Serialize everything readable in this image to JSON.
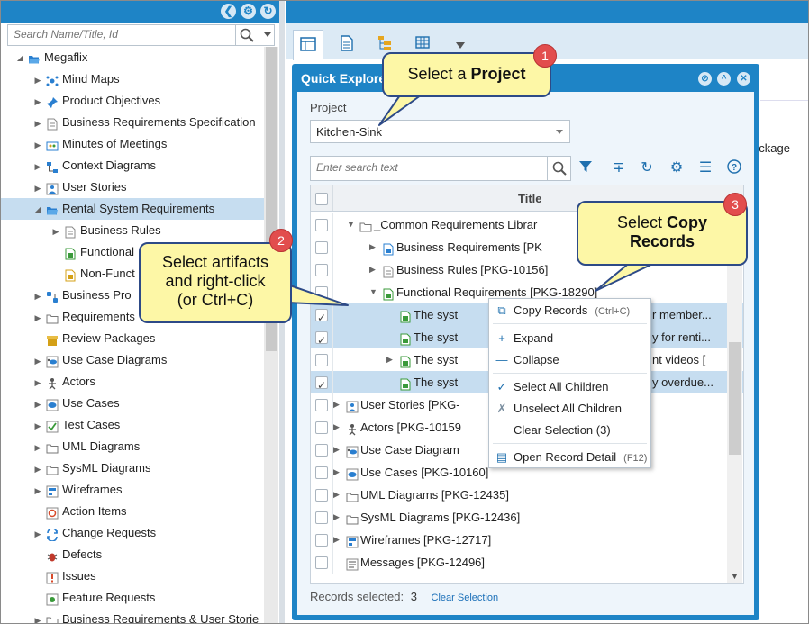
{
  "left_panel": {
    "search_placeholder": "Search Name/Title, Id",
    "tree": [
      {
        "label": "Megaflix",
        "icon": "folder-open-icon",
        "expanded": true
      },
      {
        "label": "Mind Maps",
        "icon": "mindmap-icon"
      },
      {
        "label": "Product Objectives",
        "icon": "pin-icon"
      },
      {
        "label": "Business Requirements Specification",
        "icon": "document-icon"
      },
      {
        "label": "Minutes of Meetings",
        "icon": "meeting-icon"
      },
      {
        "label": "Context Diagrams",
        "icon": "diagram-icon"
      },
      {
        "label": "User Stories",
        "icon": "userstory-icon"
      },
      {
        "label": "Rental System Requirements",
        "icon": "folder-open-icon",
        "expanded": true,
        "selected": true
      },
      {
        "label": "Business Rules",
        "icon": "document-icon"
      },
      {
        "label": "Functional",
        "icon": "document-green-icon"
      },
      {
        "label": "Non-Funct",
        "icon": "document-yellow-icon"
      },
      {
        "label": "Business Pro",
        "icon": "process-icon"
      },
      {
        "label": "Requirements",
        "icon": "folder-icon"
      },
      {
        "label": "Review Packages",
        "icon": "package-icon"
      },
      {
        "label": "Use Case Diagrams",
        "icon": "usecase-diagram-icon"
      },
      {
        "label": "Actors",
        "icon": "actor-icon"
      },
      {
        "label": "Use Cases",
        "icon": "usecase-icon"
      },
      {
        "label": "Test Cases",
        "icon": "testcase-icon"
      },
      {
        "label": "UML Diagrams",
        "icon": "folder-icon"
      },
      {
        "label": "SysML Diagrams",
        "icon": "folder-icon"
      },
      {
        "label": "Wireframes",
        "icon": "wireframe-icon"
      },
      {
        "label": "Action Items",
        "icon": "action-icon"
      },
      {
        "label": "Change Requests",
        "icon": "change-icon"
      },
      {
        "label": "Defects",
        "icon": "bug-icon"
      },
      {
        "label": "Issues",
        "icon": "issue-icon"
      },
      {
        "label": "Feature Requests",
        "icon": "feature-icon"
      },
      {
        "label": "Business Requirements & User Storie",
        "icon": "folder-icon"
      }
    ]
  },
  "right_bg": {
    "package_text": "ackage"
  },
  "dialog": {
    "title": "Quick Explore",
    "project_label": "Project",
    "project_value": "Kitchen-Sink",
    "search_placeholder": "Enter search text",
    "column_title": "Title",
    "rows": [
      {
        "label": "_Common Requirements Librar",
        "checked": false
      },
      {
        "label": "Business Requirements [PK",
        "checked": false
      },
      {
        "label": "Business Rules [PKG-10156]",
        "checked": false
      },
      {
        "label": "Functional Requirements [PKG-18290]",
        "checked": false
      },
      {
        "label": "The syst",
        "tail": "r member...",
        "checked": true
      },
      {
        "label": "The syst",
        "tail": "y for renti...",
        "checked": true
      },
      {
        "label": "The syst",
        "tail": "nt videos [",
        "checked": false
      },
      {
        "label": "The syst",
        "tail": "y overdue...",
        "checked": true
      },
      {
        "label": "User Stories [PKG-",
        "checked": false
      },
      {
        "label": "Actors [PKG-10159",
        "checked": false
      },
      {
        "label": "Use Case Diagram",
        "checked": false
      },
      {
        "label": "Use Cases [PKG-10160]",
        "checked": false
      },
      {
        "label": "UML Diagrams [PKG-12435]",
        "checked": false
      },
      {
        "label": "SysML Diagrams [PKG-12436]",
        "checked": false
      },
      {
        "label": "Wireframes [PKG-12717]",
        "checked": false
      },
      {
        "label": "Messages [PKG-12496]",
        "checked": false
      }
    ],
    "footer_label": "Records selected:",
    "footer_count": "3",
    "clear_selection": "Clear Selection"
  },
  "context_menu": {
    "items": [
      {
        "label": "Copy Records",
        "shortcut": "(Ctrl+C)",
        "icon": "copy-icon"
      },
      {
        "label": "Expand",
        "icon": "plus-icon"
      },
      {
        "label": "Collapse",
        "icon": "minus-icon"
      },
      {
        "label": "Select All Children",
        "icon": "check-icon"
      },
      {
        "label": "Unselect All Children",
        "icon": "uncheck-icon"
      },
      {
        "label": "Clear Selection (3)",
        "icon": ""
      },
      {
        "label": "Open Record Detail",
        "shortcut": "(F12)",
        "icon": "detail-icon"
      }
    ]
  },
  "callouts": {
    "c1": {
      "badge": "1",
      "text_a": "Select a ",
      "text_b": "Project"
    },
    "c2": {
      "badge": "2",
      "line1": "Select artifacts",
      "line2": "and right-click",
      "line3": "(or Ctrl+C)"
    },
    "c3": {
      "badge": "3",
      "line1_a": "Select ",
      "line1_b": "Copy",
      "line2": "Records"
    }
  },
  "colors": {
    "header_blue": "#1e84c6",
    "selection_blue": "#c6ddf0",
    "callout_yellow": "#fdf7a6",
    "badge_red": "#e24d4d"
  }
}
